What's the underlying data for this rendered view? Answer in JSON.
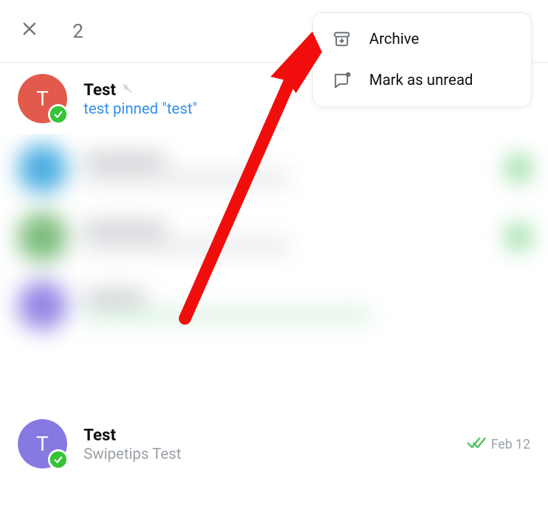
{
  "header": {
    "selection_count": "2"
  },
  "menu": {
    "archive_label": "Archive",
    "mark_unread_label": "Mark as unread"
  },
  "chats": {
    "item0": {
      "avatar_letter": "T",
      "name": "Test",
      "preview": "test pinned \"test\"",
      "muted": true,
      "selected": true
    },
    "item_last": {
      "avatar_letter": "T",
      "name": "Test",
      "preview": "Swipetips Test",
      "date": "Feb 12",
      "selected": true
    }
  }
}
